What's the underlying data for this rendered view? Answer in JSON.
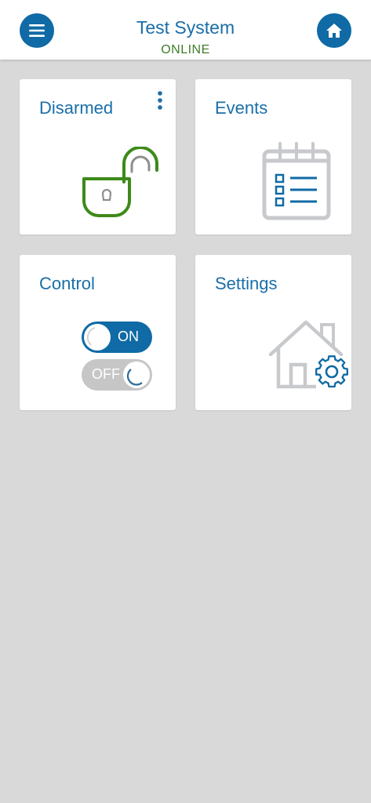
{
  "header": {
    "title": "Test System",
    "status": "ONLINE",
    "menu_icon": "hamburger-menu-icon",
    "home_icon": "home-icon"
  },
  "cards": {
    "disarmed": {
      "label": "Disarmed",
      "icon": "unlocked-padlock-icon",
      "menu_icon": "more-vert-icon"
    },
    "events": {
      "label": "Events",
      "icon": "calendar-list-icon"
    },
    "control": {
      "label": "Control",
      "on_label": "ON",
      "off_label": "OFF"
    },
    "settings": {
      "label": "Settings",
      "icon": "house-gear-icon"
    }
  },
  "colors": {
    "accent": "#0f6aa5",
    "online": "#3d7d2a",
    "lock_green": "#3d8a1a",
    "background": "#d9d9d9"
  }
}
